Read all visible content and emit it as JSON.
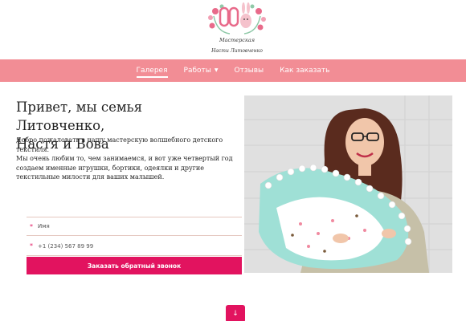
{
  "logo": {
    "line1": "Мастерская",
    "line2": "Насти Литовченко"
  },
  "nav": {
    "items": [
      {
        "label": "Галерея",
        "active": true
      },
      {
        "label": "Работы",
        "dropdown": true
      },
      {
        "label": "Отзывы"
      },
      {
        "label": "Как заказать"
      }
    ]
  },
  "intro": {
    "heading_line1": "Привет, мы семья Литовченко,",
    "heading_line2": "Настя и Вова",
    "paragraph1": "Добро пожаловать в нашу мастерскую волшебного детского текстиля.",
    "paragraph2": "Мы очень любим то, чем занимаемся, и вот уже четвертый год создаем именные игрушки, бортики, одеялки и другие текстильные милости для ваших малышей."
  },
  "form": {
    "name_placeholder": "Имя",
    "phone_placeholder": "+1 (234) 567 89 99",
    "submit_label": "Заказать обратный звонок"
  },
  "colors": {
    "accent": "#e2135f",
    "navbar": "#f28d95"
  },
  "icons": {
    "scroll_down": "arrow-down-icon"
  }
}
